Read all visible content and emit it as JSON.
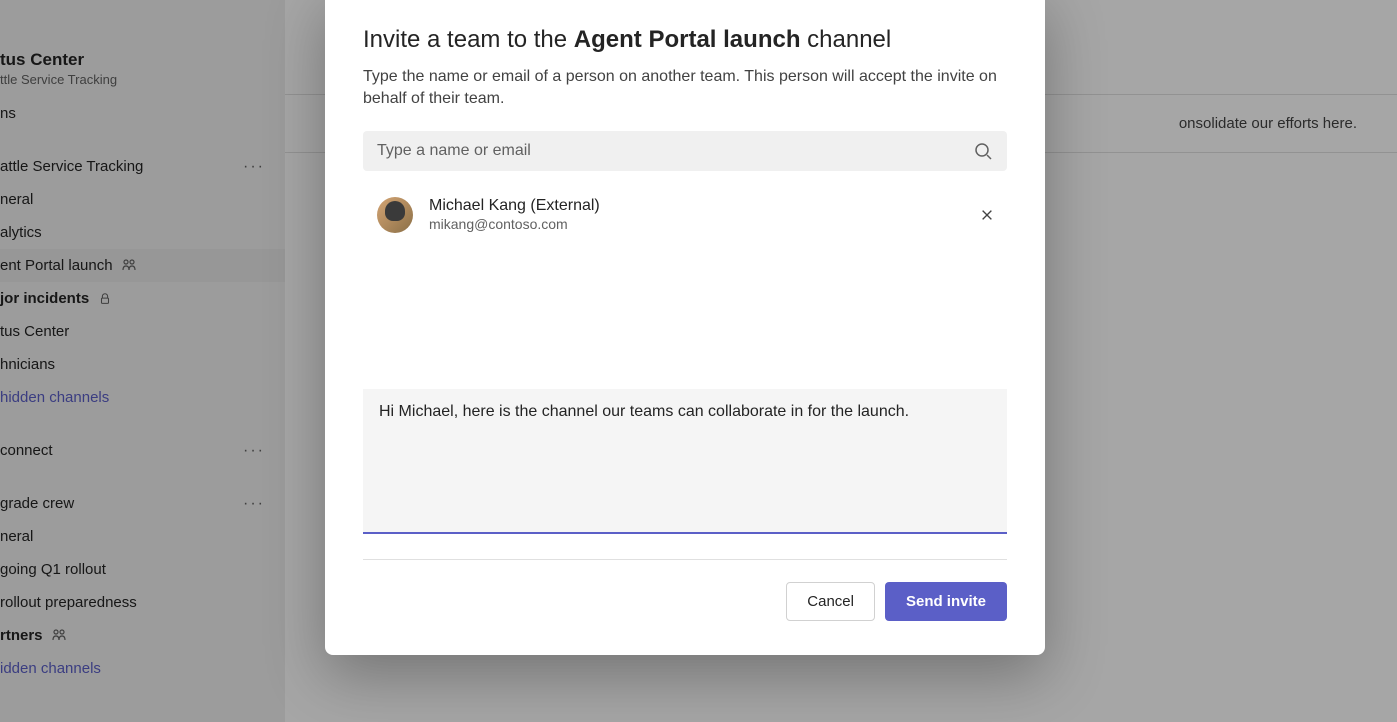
{
  "sidebar": {
    "header": {
      "title": "tus Center",
      "subtitle": "ttle Service Tracking"
    },
    "section1": {
      "item0": "ns",
      "item1": "attle Service Tracking"
    },
    "channels1": {
      "general": "neral",
      "analytics": "alytics",
      "agentPortal": "ent Portal launch",
      "majorIncidents": "jor incidents",
      "statusCenter": "tus Center",
      "technicians": "hnicians",
      "hidden": "hidden channels"
    },
    "section2": {
      "connect": "connect",
      "gradeCrew": "grade crew"
    },
    "channels2": {
      "general": "neral",
      "q1rollout": "going Q1 rollout",
      "rolloutPrep": " rollout preparedness",
      "partners": "rtners",
      "hidden": "idden channels"
    }
  },
  "main": {
    "info": "onsolidate our efforts here."
  },
  "modal": {
    "titlePrefix": "Invite a team to the ",
    "titleBold": "Agent Portal launch",
    "titleSuffix": " channel",
    "subtitle": "Type the name or email of a person on another team. This person will accept the invite on behalf of their team.",
    "searchPlaceholder": "Type a name or email",
    "person": {
      "name": "Michael Kang (External)",
      "email": "mikang@contoso.com"
    },
    "message": "Hi Michael, here is the channel our teams can collaborate in for the launch.",
    "cancelLabel": "Cancel",
    "sendLabel": "Send invite"
  }
}
